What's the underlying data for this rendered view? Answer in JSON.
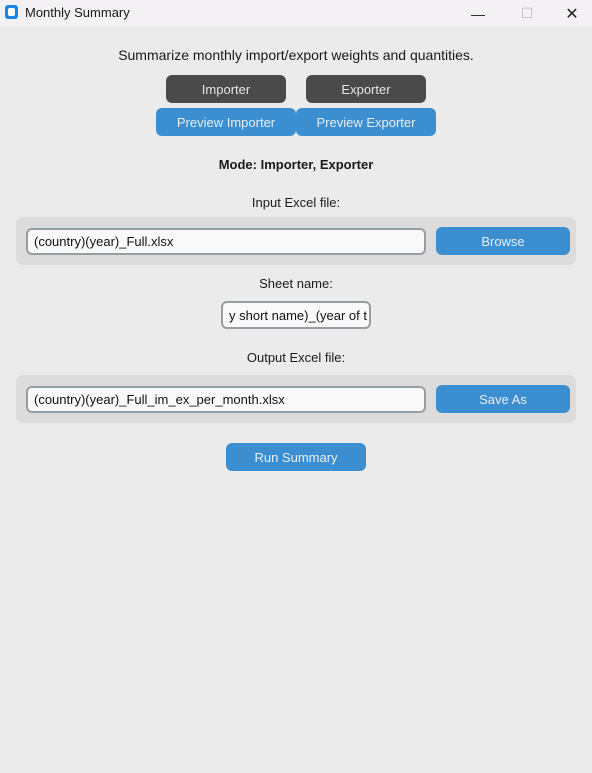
{
  "window": {
    "title": "Monthly Summary",
    "minimize": "—",
    "maximize": "☐",
    "close": "✕"
  },
  "description": "Summarize monthly import/export weights and quantities.",
  "buttons": {
    "importer": "Importer",
    "exporter": "Exporter",
    "preview_importer": "Preview Importer",
    "preview_exporter": "Preview Exporter",
    "browse": "Browse",
    "save_as": "Save As",
    "run": "Run Summary"
  },
  "mode": "Mode: Importer, Exporter",
  "input": {
    "label": "Input Excel file:",
    "value": "(country)(year)_Full.xlsx"
  },
  "sheet": {
    "label": "Sheet name:",
    "value": "y short name)_(year of t"
  },
  "output": {
    "label": "Output Excel file:",
    "value": "(country)(year)_Full_im_ex_per_month.xlsx"
  },
  "colors": {
    "accent": "#3b8ed0",
    "dark_button": "#4a4a4a",
    "background": "#ebebeb"
  }
}
